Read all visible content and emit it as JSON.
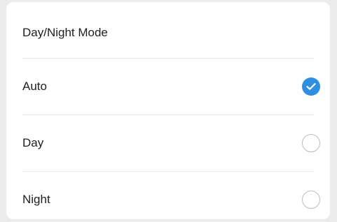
{
  "dialog": {
    "title": "Day/Night Mode",
    "options": [
      {
        "label": "Auto",
        "selected": true
      },
      {
        "label": "Day",
        "selected": false
      },
      {
        "label": "Night",
        "selected": false
      }
    ]
  },
  "colors": {
    "accent": "#2f8ee0",
    "radio_border": "#bdbdbd",
    "divider": "#e9e9e9",
    "text": "#1e1e1e"
  },
  "icons": {
    "selected": "check-circle-icon",
    "unselected": "radio-empty-icon"
  }
}
